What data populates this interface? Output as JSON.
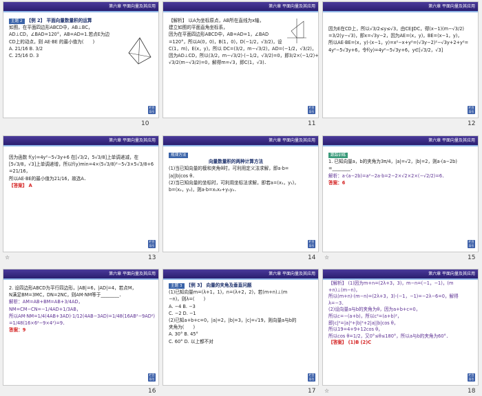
{
  "header_text": "第六章  平面向量及其应用",
  "back_label": "栏目导引",
  "slides": [
    {
      "number": "10",
      "lines": [
        "【例 2】 平面向量数量积的运算",
        "如图，在平面四边形ABCD中，AB⊥BC，",
        "AD⊥CD，∠BAD=120°，AB=AD=1.若点E为边",
        "CD上的动点，则 AE·BE 的最小值为(　　)",
        "A. 21/16          B. 3/2",
        "C. 25/16          D. 3"
      ]
    },
    {
      "number": "11",
      "lines": [
        "【解析】 以A为坐标原点，AB所在直线为x轴，",
        "建立如图的平面直角坐标系，",
        "因为在平面四边形ABCD中，AB=AD=1，∠BAD",
        "=120°，所以A(0，0)，B(1，0)，D(−1/2，√3/2)，设",
        "C(1，m)，E(x，y)，所以 DC=(3/2，m−√3/2)，AD=(−1/2，√3/2)，",
        "因为AD⊥CD，所以(3/2，m−√3/2)·(−1/2，√3/2)=0，即3/2×(−1/2)+",
        "√3/2(m−√3/2)=0，解得m=√3，即C(1，√3)．"
      ]
    },
    {
      "number": "12",
      "lines": [
        "因为E在CD上，所以√3/2≤y≤√3，由CE∥DC，得(x−1)(m−√3/2)",
        "=3/2(y−√3)，即x=√3y−2，因为AE=(x，y)，BE=(x−1，y)，",
        "所以AE·BE=(x，y)·(x−1，y)=x²−x+y²=(√3y−2)²−√3y+2+y²=",
        "4y²−5√3y+6，令f(y)=4y²−5√3y+6，y∈[√3/2，√3]"
      ]
    },
    {
      "number": "13",
      "lines": [
        "因为函数 f(y)=4y²−5√3y+6 在[√3/2，5√3/8]上单调递减，在",
        "[5√3/8，√3]上单调递增，所以f(y)min=4×(5√3/8)²−5√3×5√3/8+6",
        "=21/16，",
        "所以AE·BE的最小值为21/16，故选A．",
        "【答案】 A"
      ]
    },
    {
      "number": "14",
      "lines": [
        "规律方法",
        "向量数量积的两种计算方法",
        "(1)当已知向量的模和夹角θ时，可利用定义法求解，即a·b=",
        "|a||b|cos θ．",
        "(2)当已知向量的坐标时，可利用坐标法求解，即若a=(x₁，y₁)，",
        "b=(x₂，y₂)，则a·b=x₁x₂+y₁y₂．"
      ]
    },
    {
      "number": "15",
      "lines": [
        "跟踪训练",
        "1. 已知向量a，b的夹角为3π/4，|a|=√2，|b|=2，则a·(a−2b)",
        "=________．",
        "解析：a·(a−2b)=a²−2a·b=2−2×√2×2×(−√2/2)=6．",
        "答案：6"
      ]
    },
    {
      "number": "16",
      "lines": [
        "2. 设四边形ABCD为平行四边形，|AB|=6，|AD|=4，若点M，",
        "N满足BM=3MC，DN=2NC，则AM·NM等于________．",
        "解析：AM=AB+BM=AB+3/4AD，",
        "NM=CM−CN=−1/4AD+1/3AB，",
        "所以AM·NM=1/4(4AB+3AD)·1/12(4AB−3AD)=1/48(16AB²−9AD²)",
        "=1/48(16×6²−9×4²)=9．",
        "答案：9"
      ]
    },
    {
      "number": "17",
      "lines": [
        "【例 3】 向量的夹角及垂直问题",
        "(1)已知向量m=(λ+1，1)，n=(λ+2，2)，若(m+n)⊥(m",
        "−n)，则λ=(　　)",
        "A. −4          B. −3",
        "C. −2          D. −1",
        "(2)已知a+b+c=0，|a|=2，|b|=3，|c|=√19，则向量a与b的",
        "夹角为(　　)",
        "A. 30°          B. 45°",
        "C. 60°          D. 以上都不对"
      ]
    },
    {
      "number": "18",
      "lines": [
        "【解析】 (1)因为m+n=(2λ+3，3)，m−n=(−1，−1)，(m",
        "+n)⊥(m−n)，",
        "所以(m+n)·(m−n)=(2λ+3，3)·(−1，−1)=−2λ−6=0，解得",
        "λ=−3．",
        "(2)设向量a与b的夹角为θ，因为a+b+c=0，",
        "所以c=−(a+b)，所以c²=(a+b)²，",
        "即|c|²=|a|²+|b|²+2|a||b|cos θ，",
        "所以19=4+9+12cos θ，",
        "所以cos θ=1/2，又0°≤θ≤180°，所以a与b的夹角为60°．",
        "【答案】 (1)B (2)C"
      ]
    }
  ]
}
